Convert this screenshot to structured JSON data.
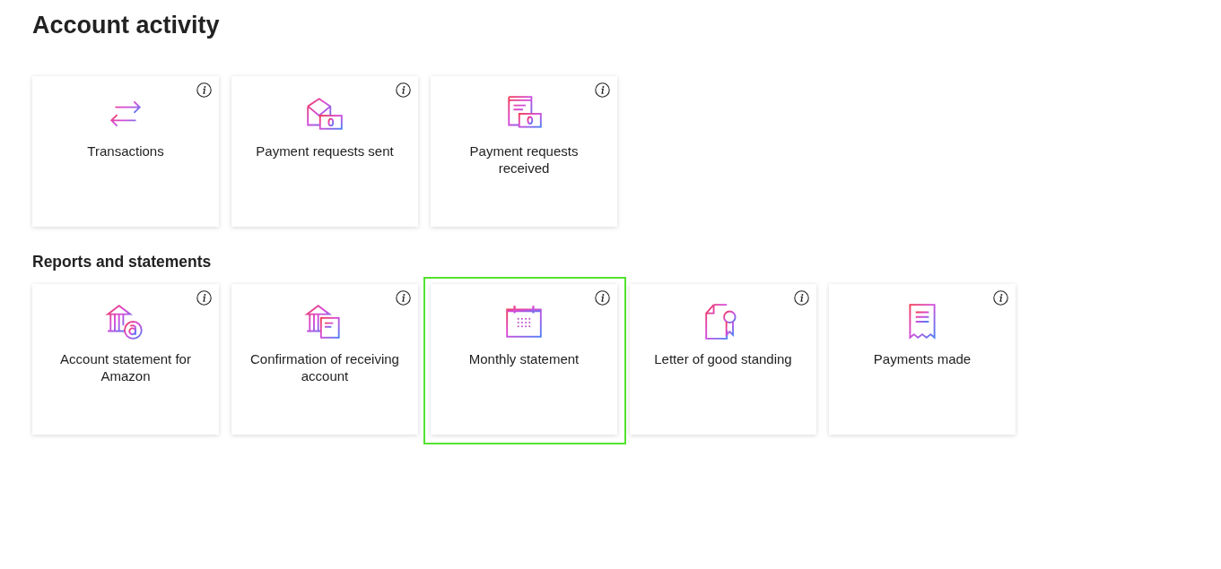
{
  "title": "Account activity",
  "sections": [
    {
      "cards": [
        {
          "kind": "transfer",
          "label": "Transactions",
          "selected": false
        },
        {
          "kind": "envelope-bill",
          "label": "Payment requests sent",
          "selected": false
        },
        {
          "kind": "document-bill",
          "label": "Payment requests received",
          "selected": false
        }
      ]
    },
    {
      "heading": "Reports and statements",
      "cards": [
        {
          "kind": "bank-circle",
          "label": "Account statement for Amazon",
          "selected": false
        },
        {
          "kind": "bank-document",
          "label": "Confirmation of receiving account",
          "selected": false
        },
        {
          "kind": "calendar",
          "label": "Monthly statement",
          "selected": true
        },
        {
          "kind": "certificate",
          "label": "Letter of good standing",
          "selected": false
        },
        {
          "kind": "receipt",
          "label": "Payments made",
          "selected": false
        }
      ]
    }
  ]
}
